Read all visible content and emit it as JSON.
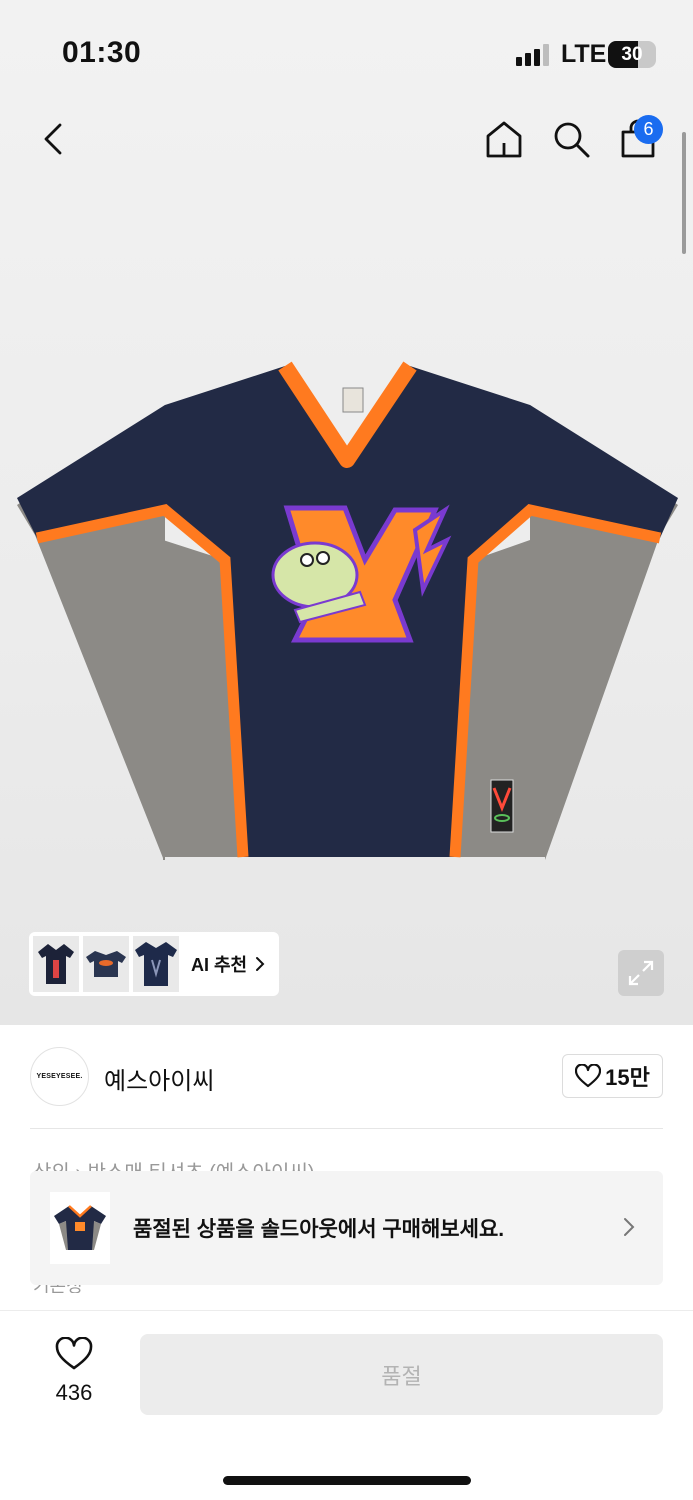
{
  "status": {
    "time": "01:30",
    "network": "LTE",
    "battery": "30",
    "battery_level": 0.3
  },
  "nav": {
    "cart_count": "6"
  },
  "icons": {
    "back": "chevron-left-icon",
    "home": "home-icon",
    "search": "search-icon",
    "cart": "shopping-bag-icon",
    "expand": "expand-icon",
    "heart": "heart-icon",
    "chevron": "chevron-right-icon"
  },
  "ai": {
    "label": "AI 추천"
  },
  "brand": {
    "name": "예스아이씨",
    "logo_text": "YESEYESEE.",
    "likes": "15만"
  },
  "banner": {
    "text": "품절된 상품을 솔드아웃에서 구매해보세요."
  },
  "partial_text": {
    "line1": "상의 › 반소매 티셔츠 (예스아이씨)",
    "line2": "기본정"
  },
  "bottom": {
    "wish_count": "436",
    "buy_label": "품절"
  },
  "colors": {
    "accent_blue": "#1a6cf0",
    "jersey_navy": "#222a45",
    "jersey_orange": "#ff7a1f",
    "jersey_gray": "#8c8a86"
  }
}
